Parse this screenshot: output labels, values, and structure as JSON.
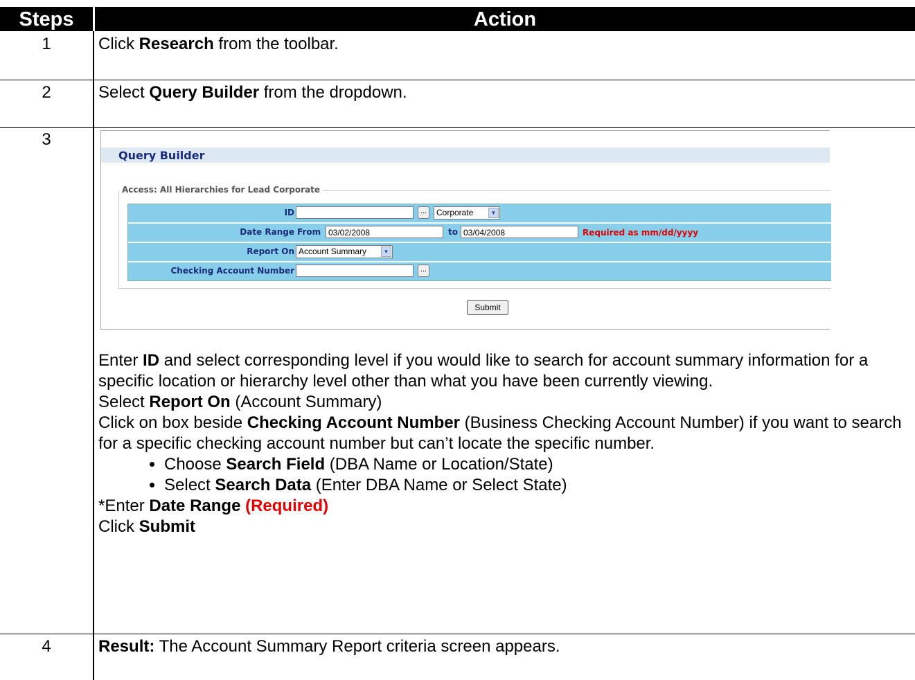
{
  "header": {
    "steps": "Steps",
    "action": "Action"
  },
  "rows": [
    {
      "step": "1",
      "pre": "Click ",
      "bold": "Research",
      "post": " from the toolbar."
    },
    {
      "step": "2",
      "pre": "Select ",
      "bold": "Query Builder",
      "post": " from the dropdown."
    },
    {
      "step": "3"
    },
    {
      "step": "4",
      "bold": "Result:",
      "post": " The Account Summary Report criteria screen appears."
    }
  ],
  "query_builder": {
    "title": "Query Builder",
    "legend": "Access: All Hierarchies for Lead Corporate",
    "id_label": "ID",
    "id_value": "",
    "browse_label": "...",
    "level_selected": "Corporate",
    "date_range_label": "Date Range",
    "from_label": "From",
    "from_value": "03/02/2008",
    "to_label": "to",
    "to_value": "03/04/2008",
    "date_hint": "Required as mm/dd/yyyy",
    "report_on_label": "Report On",
    "report_on_selected": "Account Summary",
    "checking_label": "Checking Account Number",
    "checking_value": "",
    "submit_label": "Submit"
  },
  "instructions": {
    "p1_pre": "Enter ",
    "p1_bold": "ID",
    "p1_post": " and select corresponding level if you would like to search for account summary information for a specific location or hierarchy level other than what you have been currently viewing.",
    "p2_pre": "Select ",
    "p2_bold": "Report On",
    "p2_post": " (Account Summary)",
    "p3_pre": "Click on box beside ",
    "p3_bold": "Checking Account Number",
    "p3_post": " (Business Checking Account Number) if you want to search for a specific checking account number but can’t locate the specific number.",
    "b1_pre": "Choose ",
    "b1_bold": "Search Field",
    "b1_post": " (DBA Name or Location/State)",
    "b2_pre": "Select ",
    "b2_bold": "Search Data",
    "b2_post": " (Enter DBA Name or Select State)",
    "p4_pre": "*Enter ",
    "p4_bold": "Date Range",
    "p4_red": "(Required)",
    "p5_pre": "Click ",
    "p5_bold": "Submit"
  }
}
